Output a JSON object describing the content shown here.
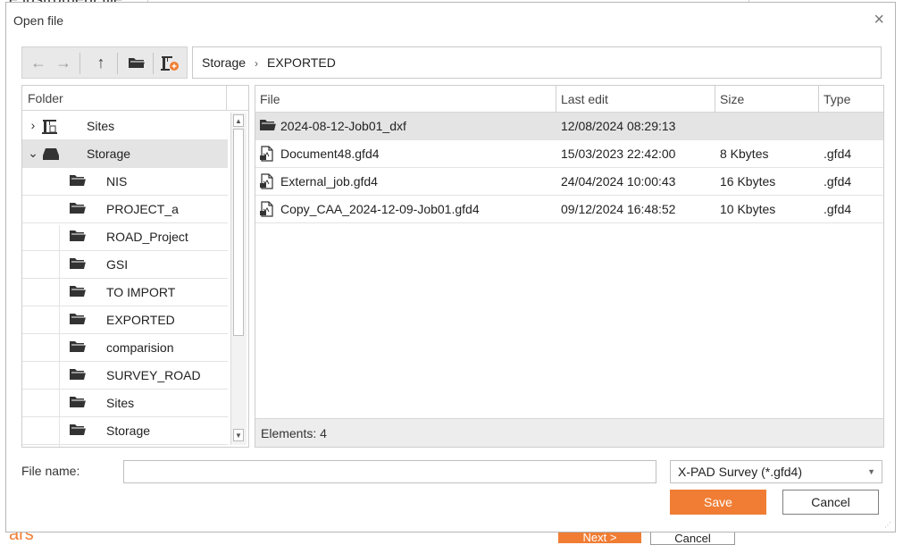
{
  "background": {
    "partial_title": "e instrument file",
    "bottom_text": "ars",
    "next_label": "Next >",
    "cancel_label": "Cancel"
  },
  "dialog": {
    "title": "Open file",
    "close_glyph": "×"
  },
  "toolbar": {
    "back_icon": "arrow-left",
    "forward_icon": "arrow-right",
    "up_icon": "arrow-up",
    "new_folder_icon": "folder",
    "add_site_icon": "add-site"
  },
  "address": {
    "segments": [
      "Storage",
      "EXPORTED"
    ],
    "separator": "›"
  },
  "folder_pane": {
    "header": "Folder",
    "items": [
      {
        "label": "Sites",
        "icon": "sites-icon",
        "expander": "›",
        "level": 0
      },
      {
        "label": "Storage",
        "icon": "storage-icon",
        "expander": "⌄",
        "level": 0,
        "selected": true
      },
      {
        "label": "NIS",
        "icon": "folder-icon",
        "level": 1
      },
      {
        "label": "PROJECT_a",
        "icon": "folder-icon",
        "level": 1
      },
      {
        "label": "ROAD_Project",
        "icon": "folder-icon",
        "level": 1
      },
      {
        "label": "GSI",
        "icon": "folder-icon",
        "level": 1
      },
      {
        "label": "TO IMPORT",
        "icon": "folder-icon",
        "level": 1
      },
      {
        "label": "EXPORTED",
        "icon": "folder-icon",
        "level": 1
      },
      {
        "label": "comparision",
        "icon": "folder-icon",
        "level": 1
      },
      {
        "label": "SURVEY_ROAD",
        "icon": "folder-icon",
        "level": 1
      },
      {
        "label": "Sites",
        "icon": "folder-icon",
        "level": 1
      },
      {
        "label": "Storage",
        "icon": "folder-icon",
        "level": 1
      }
    ]
  },
  "file_pane": {
    "columns": [
      "File",
      "Last edit",
      "Size",
      "Type"
    ],
    "rows": [
      {
        "name": "2024-08-12-Job01_dxf",
        "last_edit": "12/08/2024 08:29:13",
        "size": "",
        "type": "",
        "icon": "folder-icon",
        "selected": true
      },
      {
        "name": "Document48.gfd4",
        "last_edit": "15/03/2023 22:42:00",
        "size": "8 Kbytes",
        "type": ".gfd4",
        "icon": "file-icon"
      },
      {
        "name": "External_job.gfd4",
        "last_edit": "24/04/2024 10:00:43",
        "size": "16 Kbytes",
        "type": ".gfd4",
        "icon": "file-icon"
      },
      {
        "name": "Copy_CAA_2024-12-09-Job01.gfd4",
        "last_edit": "09/12/2024 16:48:52",
        "size": "10 Kbytes",
        "type": ".gfd4",
        "icon": "file-icon"
      }
    ],
    "footer": "Elements: 4"
  },
  "file_name": {
    "label": "File name:",
    "value": ""
  },
  "filter": {
    "selected": "X-PAD Survey (*.gfd4)"
  },
  "buttons": {
    "save": "Save",
    "cancel": "Cancel"
  },
  "colors": {
    "accent": "#f07d33",
    "selection": "#e4e4e4"
  }
}
